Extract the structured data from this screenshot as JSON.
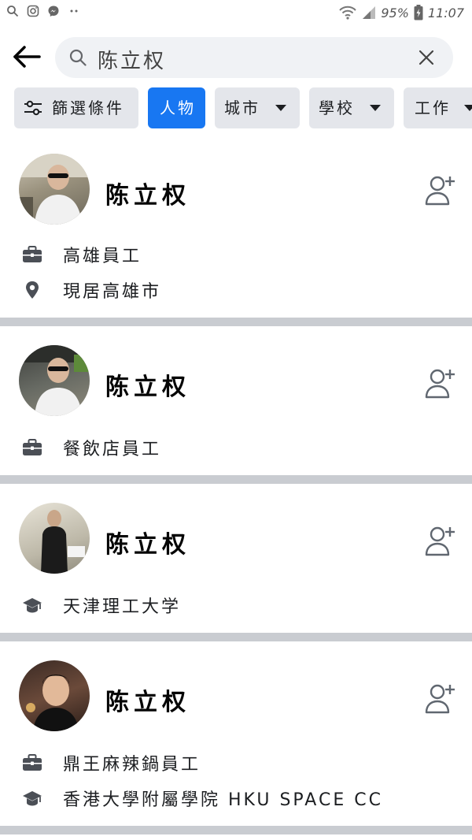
{
  "status_bar": {
    "battery": "95%",
    "time": "11:07"
  },
  "search": {
    "query": "陈立权"
  },
  "filters": [
    {
      "label": "篩選條件",
      "icon": "filter-sliders-icon",
      "active": false
    },
    {
      "label": "人物",
      "active": true
    },
    {
      "label": "城市",
      "has_dropdown": true,
      "active": false
    },
    {
      "label": "學校",
      "has_dropdown": true,
      "active": false
    },
    {
      "label": "工作",
      "has_dropdown": true,
      "active": false
    }
  ],
  "results": [
    {
      "name": "陈立权",
      "info": [
        {
          "icon": "briefcase-icon",
          "text": "高雄員工"
        },
        {
          "icon": "location-pin-icon",
          "text": "現居高雄市"
        }
      ]
    },
    {
      "name": "陈立权",
      "info": [
        {
          "icon": "briefcase-icon",
          "text": "餐飲店員工"
        }
      ]
    },
    {
      "name": "陈立权",
      "info": [
        {
          "icon": "graduation-cap-icon",
          "text": "天津理工大学"
        }
      ]
    },
    {
      "name": "陈立权",
      "info": [
        {
          "icon": "briefcase-icon",
          "text": "鼎王麻辣鍋員工"
        },
        {
          "icon": "graduation-cap-icon",
          "text": "香港大學附屬學院 HKU SPACE CC"
        }
      ]
    }
  ],
  "colors": {
    "accent": "#1877f2",
    "chip_bg": "#e4e6eb",
    "search_bg": "#f0f2f5",
    "separator": "#c9ccd1"
  }
}
